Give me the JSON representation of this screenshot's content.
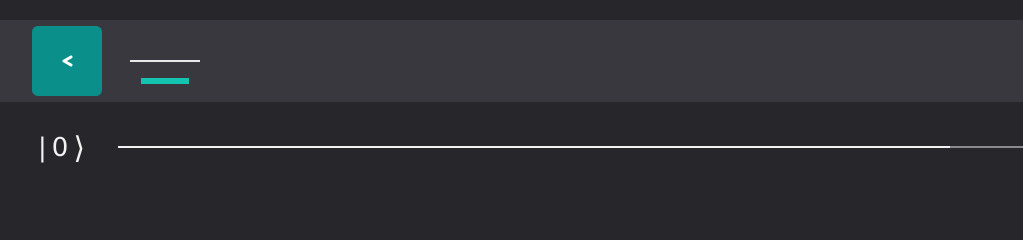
{
  "toolbar": {
    "back_button_icon": "chevron-left-icon",
    "menu_icon": "menu-icon",
    "accent_color": "#0a8f8a",
    "underline_color": "#14c3b0"
  },
  "circuit": {
    "qubits": [
      {
        "ket_open": "|",
        "state": "0",
        "ket_close": "⟩"
      }
    ]
  },
  "colors": {
    "background": "#26262b",
    "toolbar": "#38383e",
    "wire": "#f2f2f2"
  }
}
